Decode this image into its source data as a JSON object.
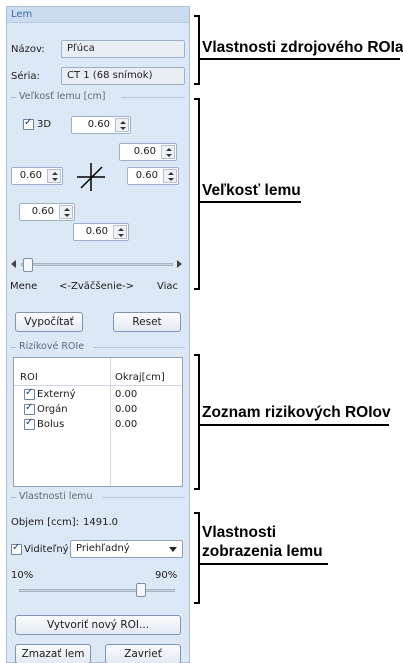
{
  "panel": {
    "title": "Lem"
  },
  "source_roi": {
    "name_label": "Názov:",
    "name_value": "Pľúca",
    "series_label": "Séria:",
    "series_value": "CT 1 (68 snímok)"
  },
  "margin_size": {
    "group_title": "Veľkosť lemu [cm]",
    "three_d_label": "3D",
    "three_d_checked": true,
    "values": {
      "top_3d": "0.60",
      "right_upper": "0.60",
      "left": "0.60",
      "right": "0.60",
      "left_lower": "0.60",
      "bottom": "0.60"
    },
    "slider": {
      "left_label": "Mene",
      "center_label": "<-Zväčšenie->",
      "right_label": "Viac"
    }
  },
  "buttons": {
    "calculate": "Vypočítať",
    "reset": "Reset",
    "create_roi": "Vytvoriť nový ROI...",
    "delete_margin": "Zmazať lem",
    "close": "Zavrieť"
  },
  "risk_rois": {
    "group_title": "Rizikové ROIe",
    "columns": [
      "ROI",
      "Okraj[cm]"
    ],
    "rows": [
      {
        "name": "Externý",
        "margin": "0.00",
        "checked": true
      },
      {
        "name": "Orgán",
        "margin": "0.00",
        "checked": true
      },
      {
        "name": "Bolus",
        "margin": "0.00",
        "checked": true
      }
    ]
  },
  "margin_properties": {
    "group_title": "Vlastnosti lemu",
    "volume_label": "Objem [ccm]:",
    "volume_value": "1491.0",
    "visible_label": "Viditeľný",
    "visible_checked": true,
    "display_mode": "Priehľadný",
    "opacity_min": "10%",
    "opacity_max": "90%",
    "opacity_level": 0.8
  },
  "annotations": {
    "source": "Vlastnosti zdrojového ROIa",
    "size": "Veľkosť lemu",
    "risk_list": "Zoznam rizikových ROIov",
    "display_line1": "Vlastnosti",
    "display_line2": "zobrazenia lemu"
  }
}
